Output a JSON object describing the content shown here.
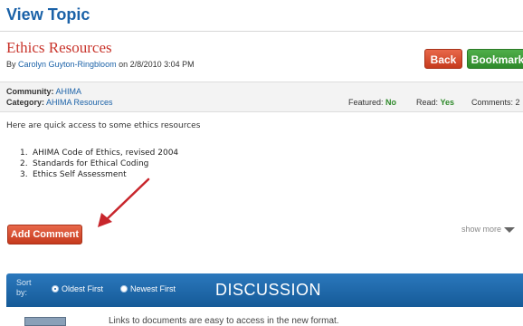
{
  "page": {
    "heading": "View Topic"
  },
  "topic": {
    "title": "Ethics Resources",
    "by_prefix": "By ",
    "author": "Carolyn Guyton-Ringbloom",
    "date": " on 2/8/2010 3:04 PM"
  },
  "actions": {
    "back_label": "Back",
    "bookmark_label": "Bookmark"
  },
  "meta": {
    "community_label": "Community:",
    "community_value": "AHIMA",
    "category_label": "Category:",
    "category_value": "AHIMA Resources",
    "featured_label": "Featured:",
    "featured_value": "No",
    "read_label": "Read:",
    "read_value": "Yes",
    "comments_label": "Comments:",
    "comments_value": "2"
  },
  "body": {
    "intro": "Here are quick access to some ethics resources",
    "resources": [
      {
        "num": "1.",
        "label": "AHIMA Code of Ethics, revised 2004"
      },
      {
        "num": "2.",
        "label": "Standards for Ethical Coding"
      },
      {
        "num": "3.",
        "label": "Ethics Self Assessment"
      }
    ]
  },
  "controls": {
    "show_more": "show more",
    "add_comment": "Add Comment"
  },
  "discussion": {
    "sort_label": "Sort by:",
    "option_oldest": "Oldest First",
    "option_newest": "Newest First",
    "selected": "Oldest First",
    "title": "DISCUSSION",
    "first_comment": "Links to documents are easy to access in the new format."
  },
  "colors": {
    "heading_blue": "#1b62a8",
    "title_red": "#c9352c",
    "status_green": "#2f8a2b",
    "annotation_arrow": "#c8262c"
  },
  "icons": {
    "show_more": "triangle-down-icon",
    "annotation": "arrow-icon"
  }
}
